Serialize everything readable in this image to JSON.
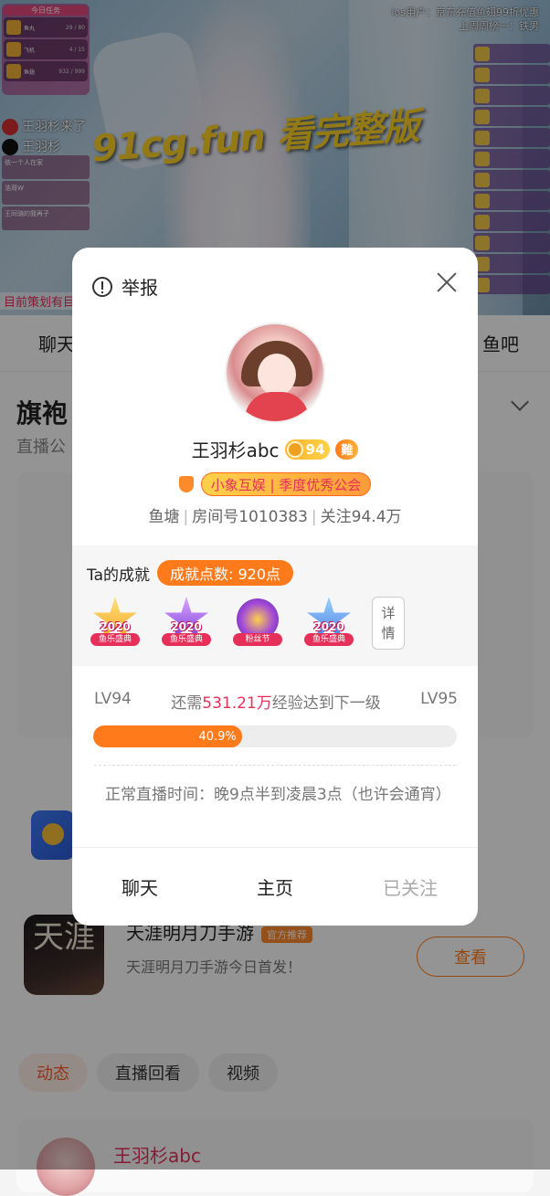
{
  "video": {
    "ios_note_line1": "ios用户：京东充值鱼翅99折优惠",
    "ios_note_line2": "上周周榜一：铁男",
    "joined_text": "王羽杉来了",
    "joined_name": "王羽杉",
    "watermark": "91cg.fun 看完整版",
    "tasks_title": "今日任务",
    "tasks": [
      {
        "label": "鱼丸",
        "value": "29 / 80"
      },
      {
        "label": "飞机",
        "value": "4 / 15"
      },
      {
        "label": "鱼翅",
        "value": "932 / 999"
      }
    ],
    "left_chats": [
      "依一个人在家",
      "浩哥W",
      "王同骑的我再子"
    ],
    "bottom_strip": "目前策划有目的"
  },
  "page": {
    "tabs": [
      "聊天",
      "鱼吧"
    ],
    "section_title": "旗袍",
    "section_sub": "直播公",
    "game": {
      "name": "天涯明月刀手游",
      "tag": "官方推荐",
      "desc": "天涯明月刀手游今日首发！",
      "view_button": "查看",
      "icon_text": "天涯"
    },
    "sub_tabs": [
      "动态",
      "直播回看",
      "视频"
    ],
    "post_name": "王羽杉abc"
  },
  "dialog": {
    "report_label": "举报",
    "name": "王羽杉abc",
    "level": "94",
    "fan_badge": "難",
    "guild": "小象互娱 | 季度优秀公会",
    "info": {
      "a": "鱼塘",
      "b": "房间号1010383",
      "c": "关注94.4万"
    },
    "ach_label": "Ta的成就",
    "ach_points": "成就点数: 920点",
    "badges": [
      {
        "text": "2020",
        "sub": "鱼乐盛典"
      },
      {
        "text": "2020",
        "sub": "鱼乐盛典"
      },
      {
        "text": "",
        "sub": "粉丝节"
      },
      {
        "text": "2020",
        "sub": "鱼乐盛典"
      }
    ],
    "detail_label": "详情",
    "level_current": "LV94",
    "level_next": "LV95",
    "need_prefix": "还需",
    "need_value": "531.21万",
    "need_suffix": "经验达到下一级",
    "progress_text": "40.9%",
    "progress_fraction": 0.409,
    "live_time": "正常直播时间：晚9点半到凌晨3点（也许会通宵）",
    "buttons": {
      "chat": "聊天",
      "home": "主页",
      "followed": "已关注"
    }
  }
}
